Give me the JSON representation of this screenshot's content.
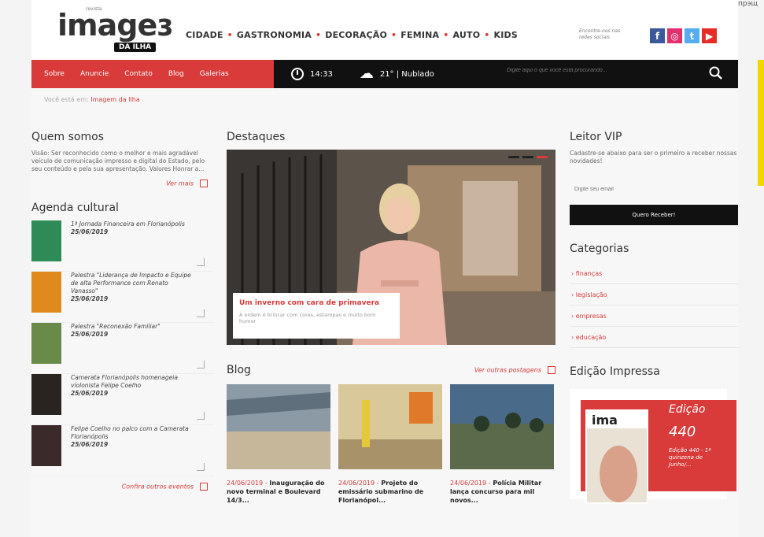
{
  "topright": "Ипрэщ",
  "header": {
    "logo_main": "imageɜ",
    "logo_sub": "DA ILHA",
    "logo_small": "revista",
    "nav": [
      "CIDADE",
      "GASTRONOMIA",
      "DECORAÇÃO",
      "FEMINA",
      "AUTO",
      "KIDS"
    ],
    "social_text": "Encontre-nos nas redes sociais",
    "social": [
      {
        "name": "facebook",
        "glyph": "f",
        "color": "#3b5998"
      },
      {
        "name": "instagram",
        "glyph": "◎",
        "color": "#e1306c"
      },
      {
        "name": "twitter",
        "glyph": "t",
        "color": "#55acee"
      },
      {
        "name": "youtube",
        "glyph": "▶",
        "color": "#e52d27"
      }
    ]
  },
  "navbar": {
    "links": [
      "Sobre",
      "Anuncie",
      "Contato",
      "Blog",
      "Galerias"
    ],
    "time": "14:33",
    "weather": "21° | Nublado",
    "search_placeholder": "Digite aqui o que você está procurando..."
  },
  "breadcrumb": {
    "prefix": "Você está em:",
    "current": "Imagem da Ilha"
  },
  "quem_somos": {
    "title": "Quem somos",
    "text": "Visão: Ser reconhecido como o melhor e mais agradável veículo de comunicação impresso e digital do Estado, pelo seu conteúdo e pela sua apresentação. Valores Honrar a...",
    "more": "Ver mais"
  },
  "agenda": {
    "title": "Agenda cultural",
    "items": [
      {
        "text": "1ª Jornada Financeira em Florianópolis",
        "date": "25/06/2019",
        "color": "#2e8b57"
      },
      {
        "text": "Palestra \"Liderança de Impacto e Equipe de alta Performance com Renato Vanasso\"",
        "date": "25/06/2019",
        "color": "#e08a1e"
      },
      {
        "text": "Palestra \"Reconexão Familiar\"",
        "date": "25/06/2019",
        "color": "#6a8a4a"
      },
      {
        "text": "Camerata Florianópolis homenageia violonista Felipe Coelho",
        "date": "25/06/2019",
        "color": "#2a2420"
      },
      {
        "text": "Felipe Coelho no palco com a Camerata Florianópolis",
        "date": "25/06/2019",
        "color": "#3a2a2a"
      }
    ],
    "more": "Confira outros eventos"
  },
  "destaques": {
    "title": "Destaques",
    "caption_title": "Um inverno com cara de primavera",
    "caption_sub": "A ordem é brincar com cores, estampas e muito bom humor"
  },
  "blog": {
    "title": "Blog",
    "more": "Ver outras postagens",
    "posts": [
      {
        "date": "24/06/2019 -",
        "title": "Inauguração do novo terminal e Boulevard 14/3...",
        "color": "#6b7e8f"
      },
      {
        "date": "24/06/2019 -",
        "title": "Projeto do emissário submarino de Florianópol...",
        "color": "#b8a45a"
      },
      {
        "date": "24/06/2019 -",
        "title": "Polícia Militar lança concurso para mil novos...",
        "color": "#4a6a8a"
      }
    ]
  },
  "leitor_vip": {
    "title": "Leitor VIP",
    "text": "Cadastre-se abaixo para ser o primeiro a receber nossas novidades!",
    "email_placeholder": "Digite seu email",
    "button": "Quero Receber!"
  },
  "categorias": {
    "title": "Categorias",
    "items": [
      "finanças",
      "legislação",
      "empresas",
      "educação"
    ]
  },
  "edicao": {
    "title": "Edição Impressa",
    "label": "Edição",
    "number": "440",
    "desc": "Edição 440 - 1ª quinzena de Junho/..."
  }
}
